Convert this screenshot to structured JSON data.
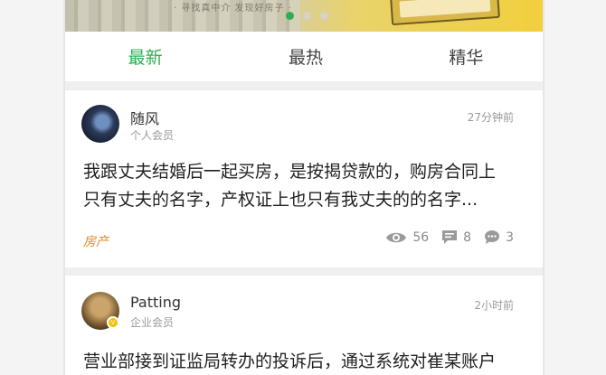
{
  "banner": {
    "slogan": "· 寻找真中介 发现好房子 ·",
    "dots": 3,
    "active_dot": 0
  },
  "tabs": [
    {
      "label": "最新",
      "active": true
    },
    {
      "label": "最热",
      "active": false
    },
    {
      "label": "精华",
      "active": false
    }
  ],
  "posts": [
    {
      "author": "随风",
      "member_type": "个人会员",
      "time": "27分钟前",
      "content_line1": "我跟丈夫结婚后一起买房，是按揭贷款的，购房合同上",
      "content_line2": "只有丈夫的名字，产权证上也只有我丈夫的的名字...",
      "tag": "房产",
      "views": "56",
      "comments": "8",
      "replies": "3"
    },
    {
      "author": "Patting",
      "member_type": "企业会员",
      "time": "2小时前",
      "content_line1": "营业部接到证监局转办的投诉后，通过系统对崔某账户"
    }
  ],
  "colors": {
    "accent": "#2fae50",
    "tag": "#e08a2e",
    "badge": "#f2c200"
  }
}
